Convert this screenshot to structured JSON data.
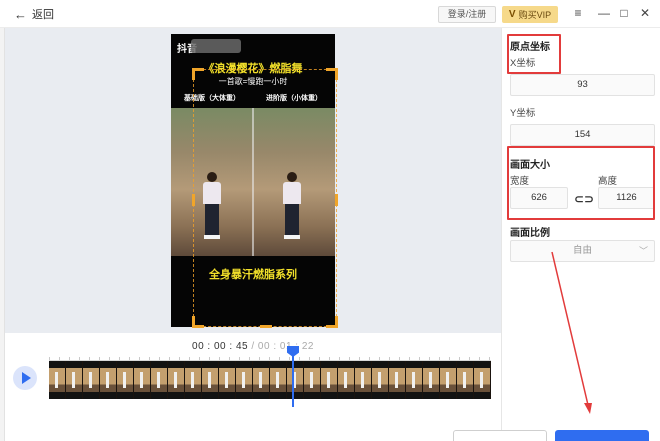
{
  "titlebar": {
    "back_label": "返回",
    "login_label": "登录/注册",
    "vip_label": "购买VIP",
    "vip_logo": "V",
    "menu_icon": "≡",
    "minimize_icon": "—",
    "maximize_icon": "□",
    "close_icon": "✕"
  },
  "preview": {
    "video_title": "《浪漫樱花》燃脂舞",
    "video_subtitle": "一首歌=慢跑一小时",
    "label_left": "基础版（大体重）",
    "label_right": "进阶版（小体重）",
    "bottom_text": "全身暴汗燃脂系列",
    "platform_logo": "抖音"
  },
  "timeline": {
    "current_time": "00 : 00 : 45",
    "separator": " / ",
    "total_time": "00 : 01 : 22"
  },
  "panel": {
    "origin_title": "原点坐标",
    "x_label": "X坐标",
    "x_value": "93",
    "y_label": "Y坐标",
    "y_value": "154",
    "size_title": "画面大小",
    "width_label": "宽度",
    "width_value": "626",
    "height_label": "高度",
    "height_value": "1126",
    "ratio_title": "画面比例",
    "ratio_value": "自由"
  },
  "bottom": {
    "ghost_label": "...",
    "primary_label": "..."
  },
  "colors": {
    "accent": "#2f6df0",
    "highlight": "#e23b3b",
    "crop_corner": "#f0a52a",
    "vip": "#f6d98a"
  }
}
